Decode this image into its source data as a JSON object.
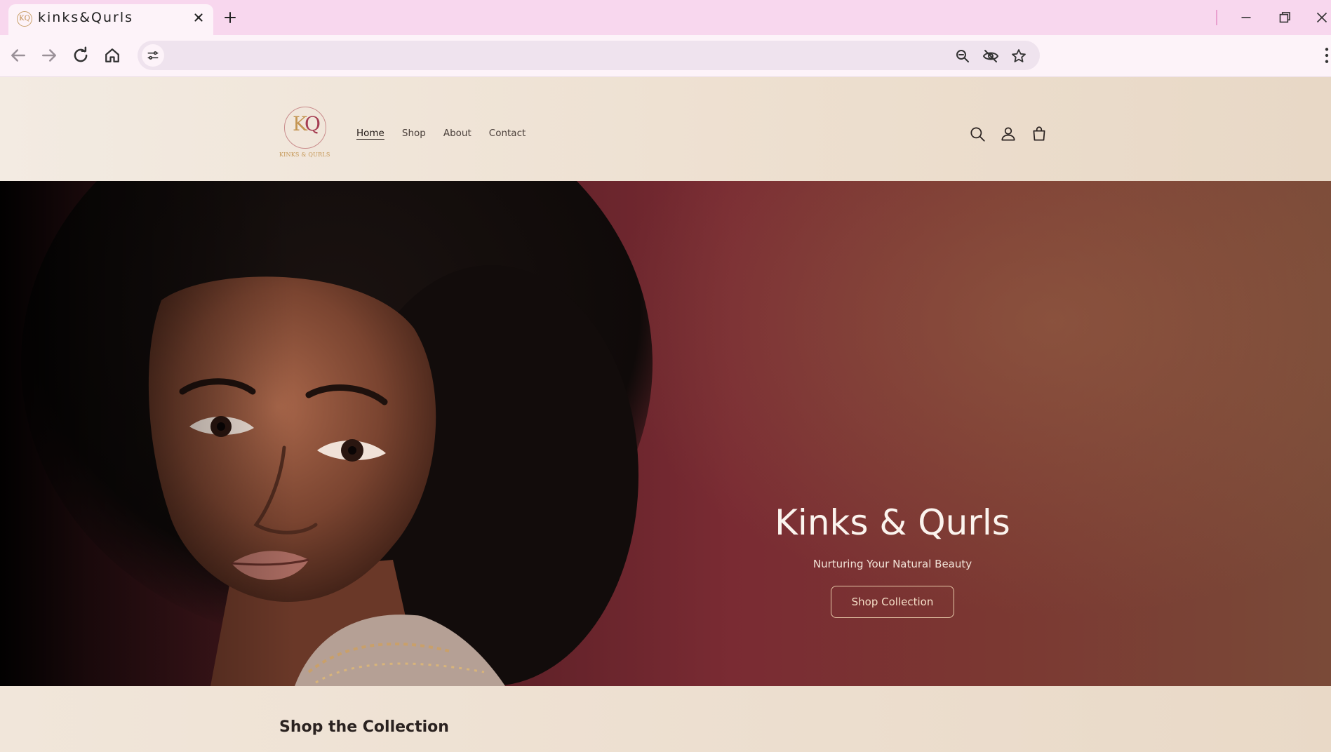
{
  "browser": {
    "tab_title": "kinks&Qurls",
    "favicon_text": "KQ"
  },
  "site": {
    "logo_mark_k": "K",
    "logo_mark_q": "Q",
    "logo_text": "KINKS & QURLS",
    "nav": [
      {
        "label": "Home",
        "active": true
      },
      {
        "label": "Shop",
        "active": false
      },
      {
        "label": "About",
        "active": false
      },
      {
        "label": "Contact",
        "active": false
      }
    ]
  },
  "hero": {
    "title": "Kinks & Qurls",
    "subtitle": "Nurturing Your Natural Beauty",
    "button_label": "Shop Collection"
  },
  "collection": {
    "title": "Shop the Collection"
  },
  "colors": {
    "tab_strip": "#f8d7ee",
    "header_bg": "#efe3d6",
    "hero_accent": "#7a2b33",
    "button_border": "#e6c8a8"
  }
}
